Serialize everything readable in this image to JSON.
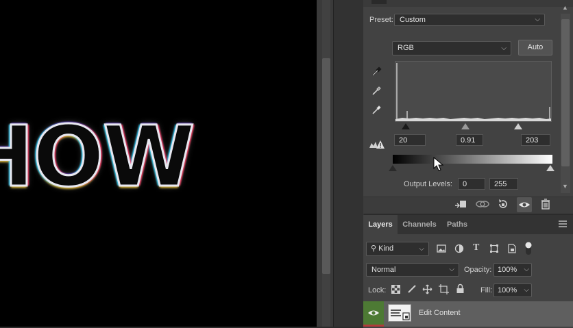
{
  "canvas": {
    "text": "HOW"
  },
  "properties": {
    "preset_label": "Preset:",
    "preset_value": "Custom",
    "channel_value": "RGB",
    "auto_label": "Auto",
    "input_black": "20",
    "input_gamma": "0.91",
    "input_white": "203",
    "output_label": "Output Levels:",
    "output_black": "0",
    "output_white": "255"
  },
  "layers": {
    "tabs": [
      {
        "label": "Layers",
        "active": true
      },
      {
        "label": "Channels",
        "active": false
      },
      {
        "label": "Paths",
        "active": false
      }
    ],
    "filter_value": "Kind",
    "blend_mode": "Normal",
    "opacity_label": "Opacity:",
    "opacity_value": "100%",
    "lock_label": "Lock:",
    "fill_label": "Fill:",
    "fill_value": "100%",
    "layer_name": "Edit Content"
  },
  "colors": {
    "accent_eye_bg": "#4d7a34",
    "panel_bg": "#424242",
    "canvas_bg": "#000000"
  }
}
